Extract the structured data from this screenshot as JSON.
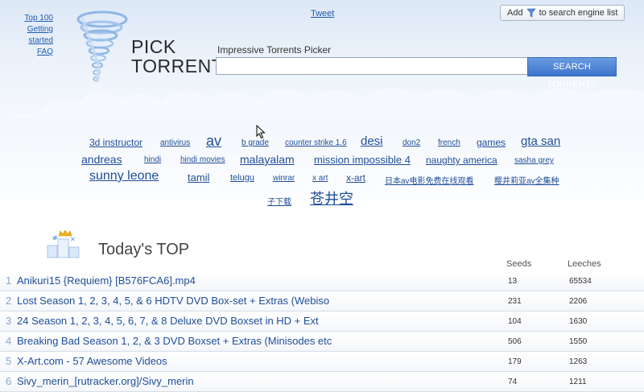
{
  "nav": {
    "links": [
      "Top 100",
      "Getting started",
      "FAQ"
    ],
    "tweet": "Tweet",
    "add_button": "to search engine list",
    "add_prefix": "Add"
  },
  "logo": {
    "line1": "PICK",
    "line2": "TORRENT"
  },
  "search": {
    "tagline": "Impressive Torrents Picker",
    "value": "",
    "button": "SEARCH TORRENTS"
  },
  "tags": [
    "3d instructor",
    "antivirus",
    "av",
    "b grade",
    "counter strike 1.6",
    "desi",
    "don2",
    "french",
    "games",
    "gta san",
    "andreas",
    "hindi",
    "hindi movies",
    "malayalam",
    "mission impossible 4",
    "naughty america",
    "sasha grey",
    "sunny leone",
    "tamil",
    "telugu",
    "winrar",
    "x art",
    "x-art",
    "日本av电影免费在线观看",
    "樱井莉亚av全集种",
    "子下载",
    "苍井空"
  ],
  "today": {
    "title": "Today's TOP",
    "col_seeds": "Seeds",
    "col_leeches": "Leeches",
    "rows": [
      {
        "num": "1",
        "name": "Anikuri15 {Requiem} [B576FCA6].mp4",
        "seeds": "13",
        "leeches": "65534"
      },
      {
        "num": "2",
        "name": "Lost Season 1, 2, 3, 4, 5, & 6 HDTV DVD Box-set + Extras (Webiso",
        "seeds": "231",
        "leeches": "2206"
      },
      {
        "num": "3",
        "name": "24 Season 1, 2, 3, 4, 5, 6, 7, & 8 Deluxe DVD Boxset in HD + Ext",
        "seeds": "104",
        "leeches": "1630"
      },
      {
        "num": "4",
        "name": "Breaking Bad Season 1, 2, & 3 DVD Boxset + Extras (Minisodes etc",
        "seeds": "506",
        "leeches": "1550"
      },
      {
        "num": "5",
        "name": "X-Art.com - 57 Awesome Videos",
        "seeds": "179",
        "leeches": "1263"
      },
      {
        "num": "6",
        "name": "Sivy_merin_[rutracker.org]/Sivy_merin",
        "seeds": "74",
        "leeches": "1211"
      }
    ]
  },
  "colors": {
    "link": "#1f4e99",
    "accent": "#3c74cc"
  }
}
